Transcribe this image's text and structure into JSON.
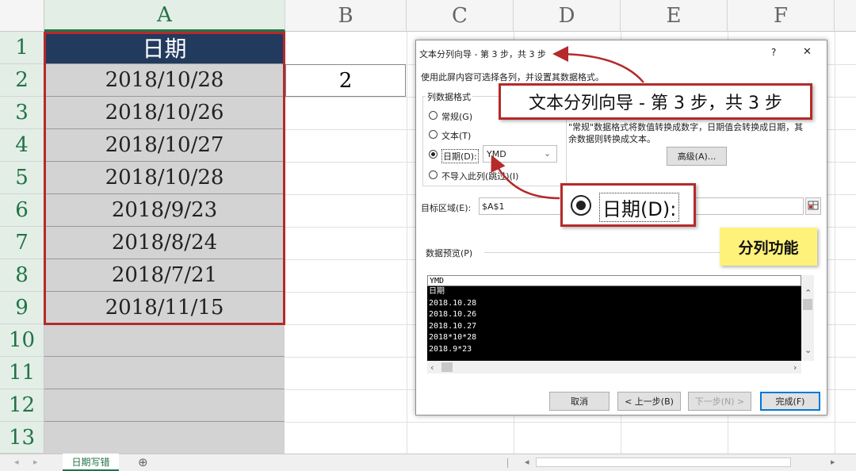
{
  "spreadsheet": {
    "columns": [
      "A",
      "B",
      "C",
      "D",
      "E",
      "F"
    ],
    "rows": [
      "1",
      "2",
      "3",
      "4",
      "5",
      "6",
      "7",
      "8",
      "9",
      "10",
      "11",
      "12",
      "13"
    ],
    "a_cells": [
      "日期",
      "2018/10/28",
      "2018/10/26",
      "2018/10/27",
      "2018/10/28",
      "2018/9/23",
      "2018/8/24",
      "2018/7/21",
      "2018/11/15"
    ],
    "b2_value": "2"
  },
  "dialog": {
    "title": "文本分列向导 - 第 3 步，共 3 步",
    "help_label": "?",
    "close_label": "✕",
    "instruction": "使用此屏内容可选择各列，并设置其数据格式。",
    "group_label": "列数据格式",
    "radio_general": "常规(G)",
    "radio_text": "文本(T)",
    "radio_date": "日期(D):",
    "date_format": "YMD",
    "radio_skip": "不导入此列(跳过)(I)",
    "description_line1": "\"常规\"数据格式将数值转换成数字，日期值会转换成日期，其",
    "description_line2": "余数据则转换成文本。",
    "advanced_button": "高级(A)...",
    "dest_label": "目标区域(E):",
    "dest_value": "$A$1",
    "preview_label": "数据预览(P)",
    "preview_header": "YMD",
    "preview_lines": [
      "日期",
      "2018.10.28",
      "2018.10.26",
      "2018.10.27",
      "2018*10*28",
      "2018.9*23"
    ],
    "cancel_button": "取消",
    "back_button": "< 上一步(B)",
    "next_button": "下一步(N) >",
    "finish_button": "完成(F)"
  },
  "callouts": {
    "title_callout": "文本分列向导 - 第 3 步，共 3 步",
    "date_callout": "日期(D):",
    "feature_note": "分列功能"
  },
  "sheet_tabs": {
    "active_tab": "日期写错",
    "add_icon": "⊕"
  },
  "colors": {
    "header_fill": "#223a5e",
    "highlight_red": "#b52a2a",
    "note_yellow": "#fff27a",
    "excel_green": "#217346"
  }
}
